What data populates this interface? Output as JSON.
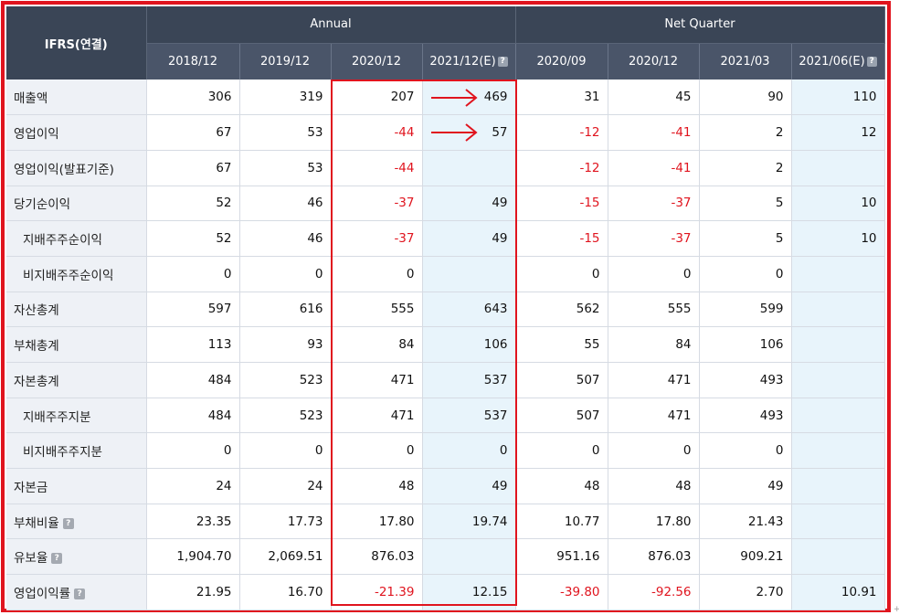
{
  "header": {
    "ifrs_label": "IFRS(연결)",
    "annual_label": "Annual",
    "quarter_label": "Net Quarter",
    "info_icon_glyph": "?"
  },
  "columns": [
    {
      "label": "2018/12",
      "estimate": false
    },
    {
      "label": "2019/12",
      "estimate": false
    },
    {
      "label": "2020/12",
      "estimate": false
    },
    {
      "label": "2021/12(E)",
      "estimate": true
    },
    {
      "label": "2020/09",
      "estimate": false
    },
    {
      "label": "2020/12",
      "estimate": false
    },
    {
      "label": "2021/03",
      "estimate": false
    },
    {
      "label": "2021/06(E)",
      "estimate": true
    }
  ],
  "rows": [
    {
      "label": "매출액",
      "indent": false,
      "info": false,
      "values": [
        "306",
        "319",
        "207",
        "469",
        "31",
        "45",
        "90",
        "110"
      ]
    },
    {
      "label": "영업이익",
      "indent": false,
      "info": false,
      "values": [
        "67",
        "53",
        "-44",
        "57",
        "-12",
        "-41",
        "2",
        "12"
      ]
    },
    {
      "label": "영업이익(발표기준)",
      "indent": false,
      "info": false,
      "values": [
        "67",
        "53",
        "-44",
        "",
        "-12",
        "-41",
        "2",
        ""
      ]
    },
    {
      "label": "당기순이익",
      "indent": false,
      "info": false,
      "values": [
        "52",
        "46",
        "-37",
        "49",
        "-15",
        "-37",
        "5",
        "10"
      ]
    },
    {
      "label": "지배주주순이익",
      "indent": true,
      "info": false,
      "values": [
        "52",
        "46",
        "-37",
        "49",
        "-15",
        "-37",
        "5",
        "10"
      ]
    },
    {
      "label": "비지배주주순이익",
      "indent": true,
      "info": false,
      "values": [
        "0",
        "0",
        "0",
        "",
        "0",
        "0",
        "0",
        ""
      ]
    },
    {
      "label": "자산총계",
      "indent": false,
      "info": false,
      "values": [
        "597",
        "616",
        "555",
        "643",
        "562",
        "555",
        "599",
        ""
      ]
    },
    {
      "label": "부채총계",
      "indent": false,
      "info": false,
      "values": [
        "113",
        "93",
        "84",
        "106",
        "55",
        "84",
        "106",
        ""
      ]
    },
    {
      "label": "자본총계",
      "indent": false,
      "info": false,
      "values": [
        "484",
        "523",
        "471",
        "537",
        "507",
        "471",
        "493",
        ""
      ]
    },
    {
      "label": "지배주주지분",
      "indent": true,
      "info": false,
      "values": [
        "484",
        "523",
        "471",
        "537",
        "507",
        "471",
        "493",
        ""
      ]
    },
    {
      "label": "비지배주주지분",
      "indent": true,
      "info": false,
      "values": [
        "0",
        "0",
        "0",
        "0",
        "0",
        "0",
        "0",
        ""
      ]
    },
    {
      "label": "자본금",
      "indent": false,
      "info": false,
      "values": [
        "24",
        "24",
        "48",
        "49",
        "48",
        "48",
        "49",
        ""
      ]
    },
    {
      "label": "부채비율",
      "indent": false,
      "info": true,
      "values": [
        "23.35",
        "17.73",
        "17.80",
        "19.74",
        "10.77",
        "17.80",
        "21.43",
        ""
      ]
    },
    {
      "label": "유보율",
      "indent": false,
      "info": true,
      "values": [
        "1,904.70",
        "2,069.51",
        "876.03",
        "",
        "951.16",
        "876.03",
        "909.21",
        ""
      ]
    },
    {
      "label": "영업이익률",
      "indent": false,
      "info": true,
      "values": [
        "21.95",
        "16.70",
        "-21.39",
        "12.15",
        "-39.80",
        "-92.56",
        "2.70",
        "10.91"
      ]
    }
  ],
  "colors": {
    "header_dark": "#3a4556",
    "header_sub": "#4a5569",
    "label_bg": "#eef1f6",
    "estimate_bg": "#e8f4fb",
    "negative": "#e0141e",
    "annotation_red": "#e0141e"
  },
  "annotations": {
    "arrow_rows": [
      0,
      1
    ]
  }
}
